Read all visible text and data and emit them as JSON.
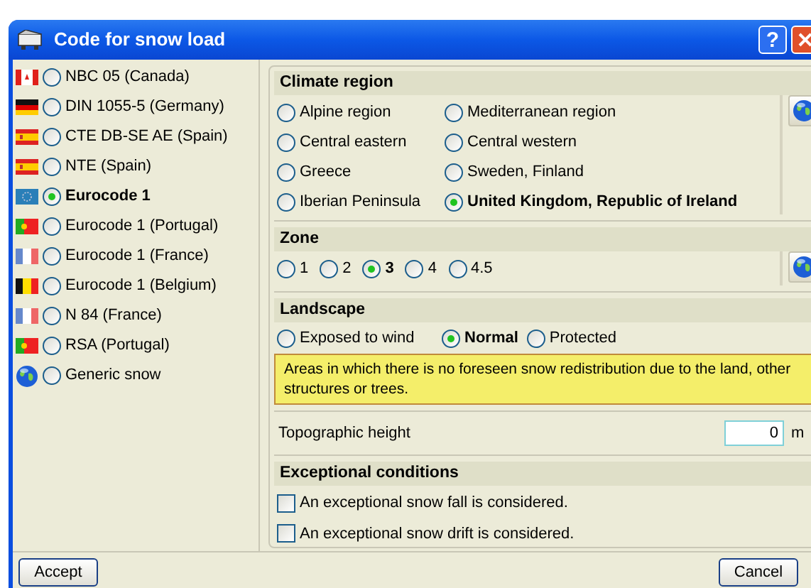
{
  "window": {
    "title": "Code for snow load",
    "help": "?"
  },
  "codes": [
    {
      "label": "NBC 05 (Canada)",
      "kind": "flag",
      "selected": false
    },
    {
      "label": "DIN 1055-5 (Germany)",
      "kind": "flag",
      "selected": false
    },
    {
      "label": "CTE DB-SE AE (Spain)",
      "kind": "flag",
      "selected": false
    },
    {
      "label": "NTE (Spain)",
      "kind": "flag",
      "selected": false
    },
    {
      "label": "Eurocode 1",
      "kind": "flag",
      "selected": true
    },
    {
      "label": "Eurocode 1 (Portugal)",
      "kind": "flag",
      "selected": false
    },
    {
      "label": "Eurocode 1 (France)",
      "kind": "flag",
      "selected": false
    },
    {
      "label": "Eurocode 1 (Belgium)",
      "kind": "flag",
      "selected": false
    },
    {
      "label": "N 84 (France)",
      "kind": "flag",
      "selected": false
    },
    {
      "label": "RSA (Portugal)",
      "kind": "flag",
      "selected": false
    },
    {
      "label": "Generic snow",
      "kind": "globe",
      "selected": false
    }
  ],
  "climate_region": {
    "title": "Climate region",
    "options": [
      {
        "label": "Alpine region",
        "selected": false
      },
      {
        "label": "Mediterranean region",
        "selected": false
      },
      {
        "label": "Central eastern",
        "selected": false
      },
      {
        "label": "Central western",
        "selected": false
      },
      {
        "label": "Greece",
        "selected": false
      },
      {
        "label": "Sweden, Finland",
        "selected": false
      },
      {
        "label": "Iberian Peninsula",
        "selected": false
      },
      {
        "label": "United Kingdom, Republic of Ireland",
        "selected": true
      }
    ]
  },
  "zone": {
    "title": "Zone",
    "options": [
      {
        "label": "1",
        "selected": false
      },
      {
        "label": "2",
        "selected": false
      },
      {
        "label": "3",
        "selected": true
      },
      {
        "label": "4",
        "selected": false
      },
      {
        "label": "4.5",
        "selected": false
      }
    ]
  },
  "landscape": {
    "title": "Landscape",
    "options": [
      {
        "label": "Exposed to wind",
        "selected": false
      },
      {
        "label": "Normal",
        "selected": true
      },
      {
        "label": "Protected",
        "selected": false
      }
    ],
    "note": "Areas in which there is no foreseen snow redistribution due to the land, other structures or trees."
  },
  "topographic_height": {
    "label": "Topographic height",
    "value": "0",
    "unit": "m"
  },
  "exceptional_conditions": {
    "title": "Exceptional conditions",
    "options": [
      {
        "label": "An exceptional snow fall is considered.",
        "checked": false
      },
      {
        "label": "An exceptional snow drift is considered.",
        "checked": false
      }
    ]
  },
  "buttons": {
    "accept": "Accept",
    "cancel": "Cancel"
  }
}
